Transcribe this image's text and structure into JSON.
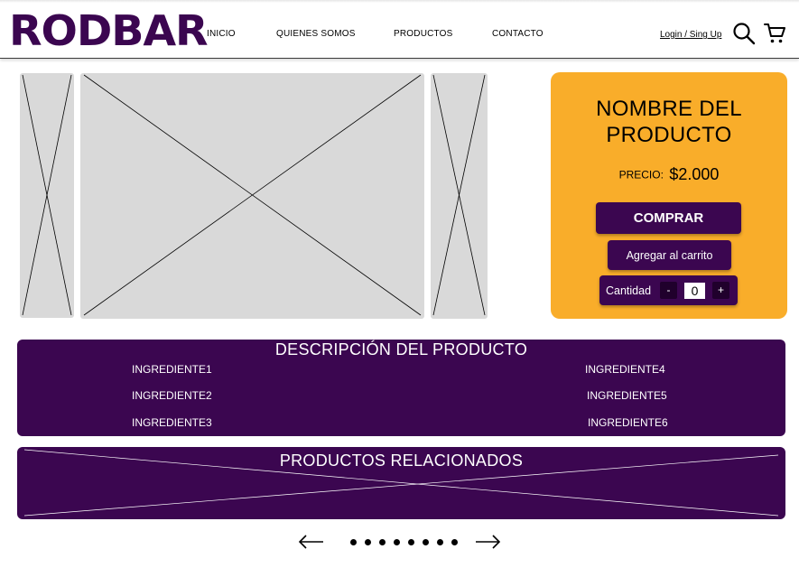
{
  "header": {
    "logo": "RODBAR",
    "nav": [
      "INICIO",
      "QUIENES SOMOS",
      "PRODUCTOS",
      "CONTACTO"
    ],
    "login": "Login / Sing Up",
    "icons": [
      "search-icon",
      "cart-icon"
    ]
  },
  "product": {
    "name_line1": "NOMBRE DEL",
    "name_line2": "PRODUCTO",
    "price_label": "PRECIO:",
    "price_value": "$2.000",
    "buy_label": "COMPRAR",
    "add_to_cart_label": "Agregar al carrito",
    "quantity_label": "Cantidad",
    "minus": "-",
    "plus": "+",
    "quantity": "0"
  },
  "description": {
    "title": "DESCRIPCIÓN DEL PRODUCTO",
    "ingredients": [
      "INGREDIENTE1",
      "INGREDIENTE2",
      "INGREDIENTE3",
      "INGREDIENTE4",
      "INGREDIENTE5",
      "INGREDIENTE6"
    ]
  },
  "related": {
    "title": "PRODUCTOS RELACIONADOS"
  },
  "pagination": {
    "dots": 8
  },
  "colors": {
    "brand_purple": "#3b0650",
    "panel_orange": "#f9ad2a",
    "placeholder_gray": "#d9d9d9"
  }
}
